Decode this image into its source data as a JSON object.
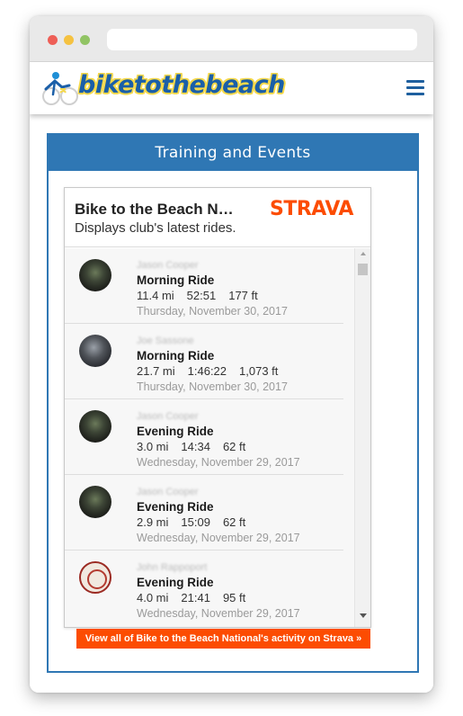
{
  "site": {
    "logo_text": "biketothebeach",
    "brand_colors": {
      "blue": "#1b5fa8",
      "yellow": "#f6d94a"
    },
    "menu_icon": "hamburger-menu-icon"
  },
  "panel": {
    "title": "Training and Events",
    "accent": "#2f77b4"
  },
  "widget": {
    "club_name": "Bike to the Beach N…",
    "description": "Displays club's latest rides.",
    "provider": "STRAVA",
    "provider_color": "#fc4c02",
    "activities": [
      {
        "athlete": "Jason Cooper",
        "title": "Morning Ride",
        "distance": "11.4 mi",
        "time": "52:51",
        "elevation": "177 ft",
        "date": "Thursday, November 30, 2017"
      },
      {
        "athlete": "Joe Sassone",
        "title": "Morning Ride",
        "distance": "21.7 mi",
        "time": "1:46:22",
        "elevation": "1,073 ft",
        "date": "Thursday, November 30, 2017"
      },
      {
        "athlete": "Jason Cooper",
        "title": "Evening Ride",
        "distance": "3.0 mi",
        "time": "14:34",
        "elevation": "62 ft",
        "date": "Wednesday, November 29, 2017"
      },
      {
        "athlete": "Jason Cooper",
        "title": "Evening Ride",
        "distance": "2.9 mi",
        "time": "15:09",
        "elevation": "62 ft",
        "date": "Wednesday, November 29, 2017"
      },
      {
        "athlete": "John Rappoport",
        "title": "Evening Ride",
        "distance": "4.0 mi",
        "time": "21:41",
        "elevation": "95 ft",
        "date": "Wednesday, November 29, 2017"
      }
    ],
    "view_all_label": "View all of Bike to the Beach National's activity on Strava »"
  }
}
